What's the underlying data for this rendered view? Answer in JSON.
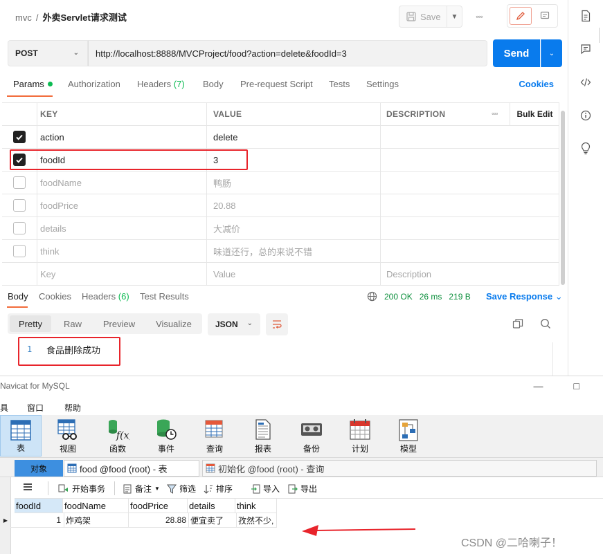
{
  "postman": {
    "breadcrumb": {
      "collection": "mvc",
      "separator": "/",
      "request_name": "外卖Servlet请求测试"
    },
    "save_label": "Save",
    "method": "POST",
    "url": "http://localhost:8888/MVCProject/food?action=delete&foodId=3",
    "send_label": "Send",
    "request_tabs": [
      {
        "label": "Params",
        "count": ""
      },
      {
        "label": "Authorization",
        "count": ""
      },
      {
        "label": "Headers",
        "count": "(7)"
      },
      {
        "label": "Body",
        "count": ""
      },
      {
        "label": "Pre-request Script",
        "count": ""
      },
      {
        "label": "Tests",
        "count": ""
      },
      {
        "label": "Settings",
        "count": ""
      }
    ],
    "cookies_label": "Cookies",
    "params_table": {
      "headers": {
        "key": "KEY",
        "value": "VALUE",
        "description": "DESCRIPTION",
        "bulk_edit": "Bulk Edit"
      },
      "rows": [
        {
          "checked": true,
          "key": "action",
          "value": "delete",
          "description": ""
        },
        {
          "checked": true,
          "key": "foodId",
          "value": "3",
          "description": ""
        },
        {
          "checked": false,
          "key": "foodName",
          "value": "鸭肠",
          "description": ""
        },
        {
          "checked": false,
          "key": "foodPrice",
          "value": "20.88",
          "description": ""
        },
        {
          "checked": false,
          "key": "details",
          "value": "大减价",
          "description": ""
        },
        {
          "checked": false,
          "key": "think",
          "value": "味道还行，总的来说不错",
          "description": ""
        }
      ],
      "placeholder": {
        "key": "Key",
        "value": "Value",
        "description": "Description"
      }
    },
    "response": {
      "tabs": [
        {
          "label": "Body",
          "count": ""
        },
        {
          "label": "Cookies",
          "count": ""
        },
        {
          "label": "Headers",
          "count": "(6)"
        },
        {
          "label": "Test Results",
          "count": ""
        }
      ],
      "status": "200 OK",
      "time": "26 ms",
      "size": "219 B",
      "save_response": "Save Response",
      "view_modes": [
        "Pretty",
        "Raw",
        "Preview",
        "Visualize"
      ],
      "format": "JSON",
      "line_number": "1",
      "body_text": "食品删除成功"
    }
  },
  "navicat": {
    "title": "Navicat for MySQL",
    "menu": [
      "具",
      "窗口",
      "帮助"
    ],
    "toolbar": [
      {
        "label": "表",
        "icon": "table-icon"
      },
      {
        "label": "视图",
        "icon": "view-icon"
      },
      {
        "label": "函数",
        "icon": "function-icon"
      },
      {
        "label": "事件",
        "icon": "event-icon"
      },
      {
        "label": "查询",
        "icon": "query-icon"
      },
      {
        "label": "报表",
        "icon": "report-icon"
      },
      {
        "label": "备份",
        "icon": "backup-icon"
      },
      {
        "label": "计划",
        "icon": "schedule-icon"
      },
      {
        "label": "模型",
        "icon": "model-icon"
      }
    ],
    "tabs": {
      "objects": "对象",
      "tab1": "food @food (root) - 表",
      "tab2": "初始化 @food (root) - 查询"
    },
    "subtoolbar": [
      "开始事务",
      "备注",
      "筛选",
      "排序",
      "导入",
      "导出"
    ],
    "grid": {
      "columns": [
        "foodId",
        "foodName",
        "foodPrice",
        "details",
        "think"
      ],
      "rows": [
        {
          "foodId": "1",
          "foodName": "炸鸡架",
          "foodPrice": "28.88",
          "details": "便宜卖了",
          "think": "孜然不少,"
        }
      ]
    },
    "watermark": "CSDN @二哈喇子！"
  },
  "colors": {
    "accent_blue": "#097bed",
    "accent_orange": "#f26b3a",
    "highlight_red": "#e8242b",
    "status_green": "#0cbb52"
  }
}
